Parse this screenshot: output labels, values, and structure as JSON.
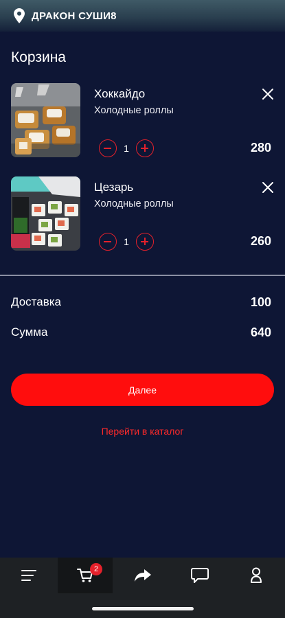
{
  "header": {
    "title": "ДРАКОН СУШИ8",
    "icon": "location-pin-icon"
  },
  "cart": {
    "title": "Корзина",
    "items": [
      {
        "name": "Хоккайдо",
        "category": "Холодные роллы",
        "quantity": "1",
        "price": "280"
      },
      {
        "name": "Цезарь",
        "category": "Холодные роллы",
        "quantity": "1",
        "price": "260"
      }
    ]
  },
  "summary": {
    "delivery_label": "Доставка",
    "delivery_value": "100",
    "total_label": "Сумма",
    "total_value": "640"
  },
  "actions": {
    "next_label": "Далее",
    "catalog_link": "Перейти в каталог"
  },
  "bottom_nav": {
    "items": [
      "menu-icon",
      "cart-icon",
      "share-icon",
      "chat-icon",
      "profile-icon"
    ],
    "cart_badge": "2"
  },
  "colors": {
    "background": "#0e1635",
    "accent": "#ff0d0d",
    "nav": "#1e2124"
  }
}
